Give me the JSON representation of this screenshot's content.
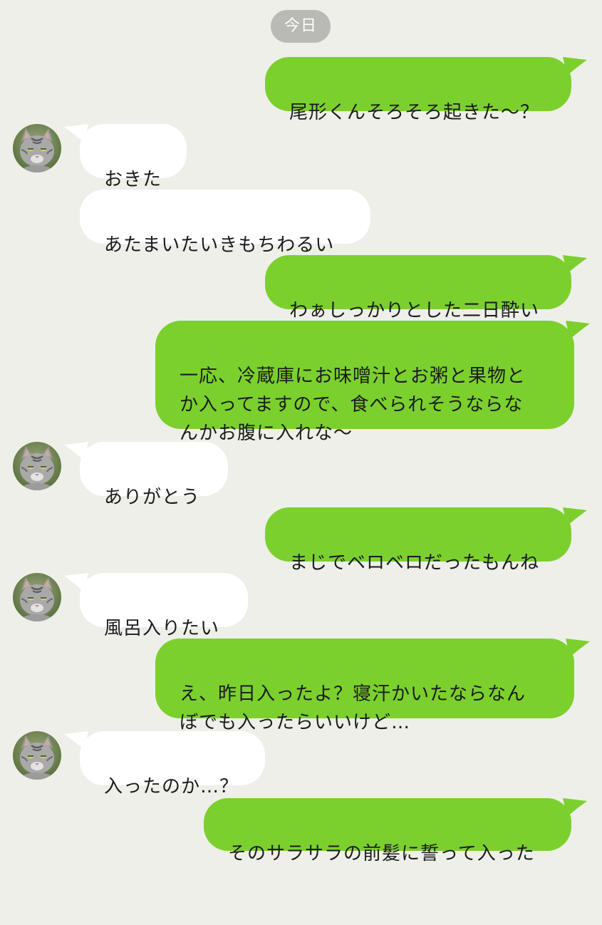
{
  "date_label": "今日",
  "colors": {
    "background": "#efefe9",
    "outgoing_bubble": "#7bd02e",
    "incoming_bubble": "#ffffff",
    "date_pill": "#b9b9b6"
  },
  "contact": {
    "avatar_icon": "cat-photo-avatar"
  },
  "messages": [
    {
      "sender": "me",
      "text": "尾形くんそろそろ起きた〜？"
    },
    {
      "sender": "other",
      "text": "おきた"
    },
    {
      "sender": "other",
      "text": "あたまいたいきもちわるい"
    },
    {
      "sender": "me",
      "text": "わぁしっかりとした二日酔い"
    },
    {
      "sender": "me",
      "text": "一応、冷蔵庫にお味噌汁とお粥と果物と\nか入ってますので、食べられそうならな\nんかお腹に入れな〜"
    },
    {
      "sender": "other",
      "text": "ありがとう"
    },
    {
      "sender": "me",
      "text": "まじでベロベロだったもんね"
    },
    {
      "sender": "other",
      "text": "風呂入りたい"
    },
    {
      "sender": "me",
      "text": "え、昨日入ったよ？寝汗かいたならなん\nぼでも入ったらいいけど…"
    },
    {
      "sender": "other",
      "text": "入ったのか…？"
    },
    {
      "sender": "me",
      "text": "そのサラサラの前髪に誓って入った"
    }
  ]
}
